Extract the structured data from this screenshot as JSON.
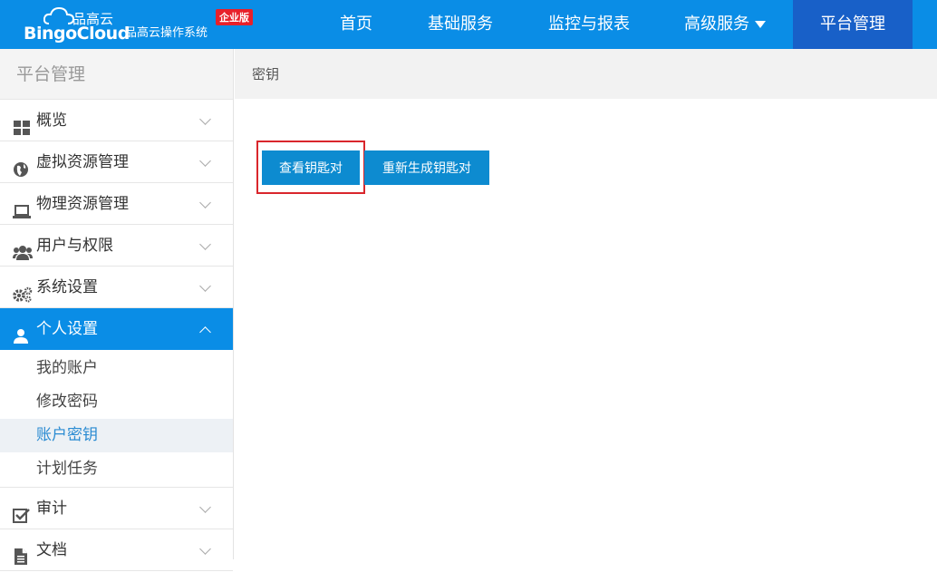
{
  "header": {
    "logo_cn": "品高云",
    "logo_en": "BingoCloud",
    "subtitle": "品高云操作系统",
    "badge": "企业版",
    "nav": [
      {
        "label": "首页"
      },
      {
        "label": "基础服务"
      },
      {
        "label": "监控与报表"
      },
      {
        "label": "高级服务"
      },
      {
        "label": "平台管理"
      }
    ],
    "active_nav": "平台管理",
    "colors": {
      "bar": "#0a8de6",
      "active": "#1860c8",
      "badge": "#e8202a"
    }
  },
  "sidebar": {
    "title": "平台管理",
    "items": [
      {
        "label": "概览",
        "icon": "grid-icon"
      },
      {
        "label": "虚拟资源管理",
        "icon": "globe-icon"
      },
      {
        "label": "物理资源管理",
        "icon": "laptop-icon"
      },
      {
        "label": "用户与权限",
        "icon": "users-icon"
      },
      {
        "label": "系统设置",
        "icon": "gears-icon"
      },
      {
        "label": "个人设置",
        "icon": "user-icon",
        "expanded": true
      },
      {
        "label": "审计",
        "icon": "checkbox-icon"
      },
      {
        "label": "文档",
        "icon": "document-icon"
      }
    ],
    "subitems": [
      {
        "label": "我的账户"
      },
      {
        "label": "修改密码"
      },
      {
        "label": "账户密钥",
        "selected": true
      },
      {
        "label": "计划任务"
      }
    ]
  },
  "main": {
    "breadcrumb": "密钥",
    "buttons": [
      {
        "label": "查看钥匙对"
      },
      {
        "label": "重新生成钥匙对"
      }
    ]
  }
}
